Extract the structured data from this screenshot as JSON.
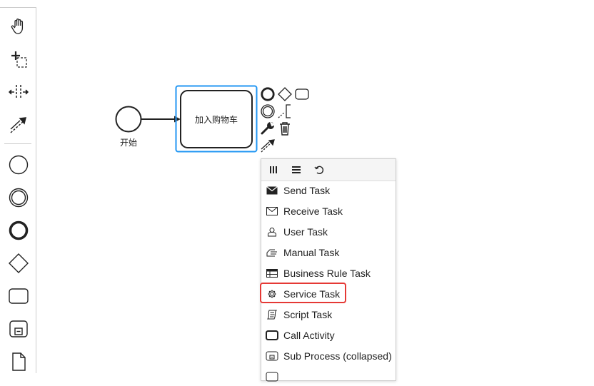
{
  "palette": {
    "tools": [
      {
        "name": "hand-tool",
        "icon": "hand-icon"
      },
      {
        "name": "lasso-tool",
        "icon": "lasso-icon"
      },
      {
        "name": "space-tool",
        "icon": "space-icon"
      },
      {
        "name": "global-connect-tool",
        "icon": "connect-icon"
      }
    ],
    "shapes": [
      {
        "name": "start-event",
        "icon": "start-event-icon"
      },
      {
        "name": "intermediate-event",
        "icon": "intermediate-event-icon"
      },
      {
        "name": "end-event",
        "icon": "end-event-icon"
      },
      {
        "name": "gateway",
        "icon": "gateway-icon"
      },
      {
        "name": "task",
        "icon": "task-icon"
      },
      {
        "name": "subprocess",
        "icon": "subprocess-icon"
      },
      {
        "name": "data-object",
        "icon": "data-object-icon"
      }
    ]
  },
  "diagram": {
    "start_event_label": "开始",
    "task_label": "加入购物车",
    "selection_color": "#2196f3"
  },
  "popup": {
    "entries": [
      {
        "label": "Send Task",
        "icon": "send-task-icon"
      },
      {
        "label": "Receive Task",
        "icon": "receive-task-icon"
      },
      {
        "label": "User Task",
        "icon": "user-task-icon"
      },
      {
        "label": "Manual Task",
        "icon": "manual-task-icon"
      },
      {
        "label": "Business Rule Task",
        "icon": "business-rule-task-icon"
      },
      {
        "label": "Service Task",
        "icon": "service-task-icon"
      },
      {
        "label": "Script Task",
        "icon": "script-task-icon"
      },
      {
        "label": "Call Activity",
        "icon": "call-activity-icon"
      },
      {
        "label": "Sub Process (collapsed)",
        "icon": "subprocess-collapsed-icon"
      }
    ],
    "highlighted": "Service Task",
    "highlight_color": "#e53935"
  }
}
